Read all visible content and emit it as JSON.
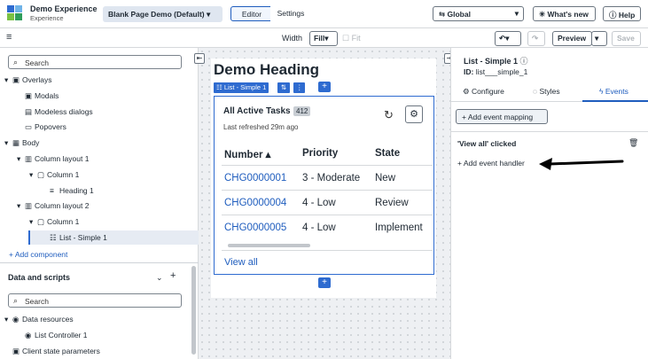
{
  "app": {
    "title": "Demo Experience",
    "subtitle": "Experience",
    "page_select": "Blank Page Demo (Default)"
  },
  "top_tabs": [
    "Editor",
    "Settings"
  ],
  "top_right": {
    "scope": "Global",
    "whats_new": "What's new",
    "help": "Help"
  },
  "toolbar": {
    "hamburger": "≡",
    "width_label": "Width",
    "fill_button": "Fill",
    "fit_label": "Fit",
    "preview": "Preview",
    "save": "Save"
  },
  "left_panel": {
    "search_placeholder": "Search",
    "tree": [
      {
        "label": "Overlays",
        "depth": 0,
        "caret": "▾",
        "icon": "▣"
      },
      {
        "label": "Modals",
        "depth": 1,
        "caret": "",
        "icon": "▣"
      },
      {
        "label": "Modeless dialogs",
        "depth": 1,
        "caret": "",
        "icon": "▤"
      },
      {
        "label": "Popovers",
        "depth": 1,
        "caret": "",
        "icon": "▭"
      },
      {
        "label": "Body",
        "depth": 0,
        "caret": "▾",
        "icon": "▦"
      },
      {
        "label": "Column layout 1",
        "depth": 1,
        "caret": "▾",
        "icon": "▥"
      },
      {
        "label": "Column 1",
        "depth": 2,
        "caret": "▾",
        "icon": "▢"
      },
      {
        "label": "Heading 1",
        "depth": 3,
        "caret": "",
        "icon": "≡"
      },
      {
        "label": "Column layout 2",
        "depth": 1,
        "caret": "▾",
        "icon": "▥"
      },
      {
        "label": "Column 1",
        "depth": 2,
        "caret": "▾",
        "icon": "▢"
      },
      {
        "label": "List - Simple 1",
        "depth": 3,
        "caret": "",
        "icon": "☷",
        "selected": true
      }
    ],
    "add_component": "+ Add component",
    "data_section_title": "Data and scripts",
    "data_search_placeholder": "Search",
    "data_tree": [
      {
        "label": "Data resources",
        "depth": 0,
        "caret": "▾",
        "icon": "◉"
      },
      {
        "label": "List Controller 1",
        "depth": 1,
        "caret": "",
        "icon": "◉"
      },
      {
        "label": "Client state parameters",
        "depth": 0,
        "caret": "",
        "icon": "▣"
      }
    ]
  },
  "canvas": {
    "heading": "Demo Heading",
    "selected_label": "List - Simple 1",
    "list_title": "All Active Tasks",
    "count": "412",
    "refreshed": "Last refreshed 29m ago",
    "columns": [
      "Number ▴",
      "Priority",
      "State"
    ],
    "rows": [
      [
        "CHG0000001",
        "3 - Moderate",
        "New"
      ],
      [
        "CHG0000004",
        "4 - Low",
        "Review"
      ],
      [
        "CHG0000005",
        "4 - Low",
        "Implement"
      ]
    ],
    "view_all": "View all"
  },
  "right_panel": {
    "title": "List - Simple 1",
    "id_label": "ID:",
    "id_value": "list___simple_1",
    "tabs": [
      "Configure",
      "Styles",
      "Events"
    ],
    "active_tab": "Events",
    "add_event_mapping": "+ Add event mapping",
    "event_name": "'View all' clicked",
    "add_event_handler": "+ Add event handler"
  },
  "colors": {
    "accent": "#2e6bd0",
    "link": "#1f5dbe"
  }
}
